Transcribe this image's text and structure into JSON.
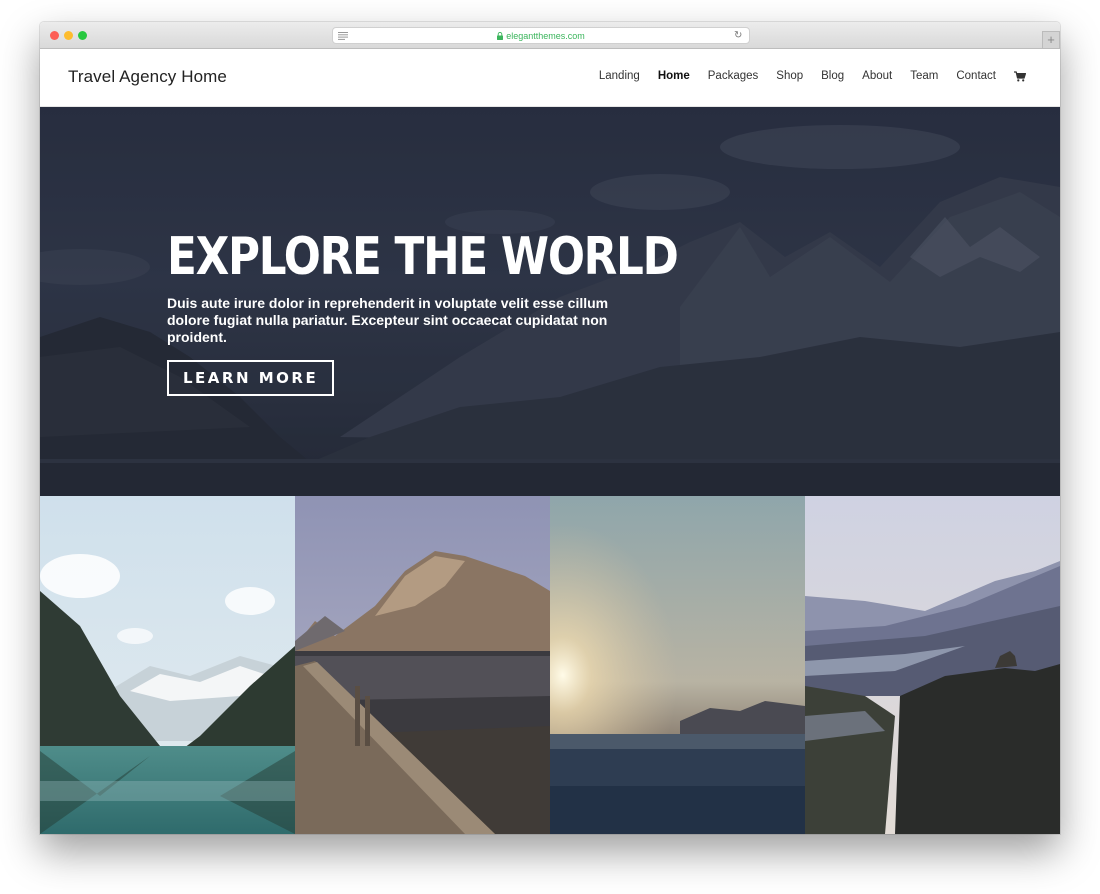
{
  "browser": {
    "url": "elegantthemes.com"
  },
  "site": {
    "title": "Travel Agency Home"
  },
  "nav": {
    "items": [
      {
        "label": "Landing"
      },
      {
        "label": "Home"
      },
      {
        "label": "Packages"
      },
      {
        "label": "Shop"
      },
      {
        "label": "Blog"
      },
      {
        "label": "About"
      },
      {
        "label": "Team"
      },
      {
        "label": "Contact"
      }
    ],
    "active": "Home",
    "cart_icon": "cart-icon"
  },
  "hero": {
    "title": "EXPLORE THE WORLD",
    "text": "Duis aute irure dolor in reprehenderit in voluptate velit esse cillum dolore fugiat nulla pariatur. Excepteur sint occaecat cupidatat non proident.",
    "button_label": "LEARN MORE"
  },
  "colors": {
    "url_green": "#3bb55c",
    "hero_overlay": "#2a3143",
    "text_dark": "#222222"
  }
}
